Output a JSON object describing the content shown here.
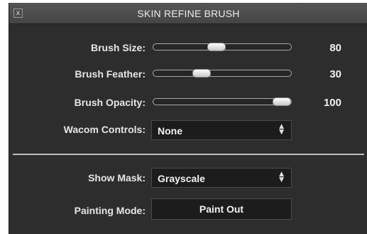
{
  "window": {
    "title": "SKIN REFINE BRUSH",
    "close_glyph": "x"
  },
  "sliders": [
    {
      "label": "Brush Size:",
      "value": "80",
      "position": 0.45
    },
    {
      "label": "Brush Feather:",
      "value": "30",
      "position": 0.33
    },
    {
      "label": "Brush Opacity:",
      "value": "100",
      "position": 1.0
    }
  ],
  "wacom": {
    "label": "Wacom Controls:",
    "selected": "None"
  },
  "mask": {
    "label": "Show Mask:",
    "selected": "Grayscale"
  },
  "painting": {
    "label": "Painting Mode:",
    "button": "Paint Out"
  },
  "colors": {
    "panel": "#2d2d2d",
    "titlebar": "#4e4e4e",
    "thumb": "#e8e8e8"
  }
}
